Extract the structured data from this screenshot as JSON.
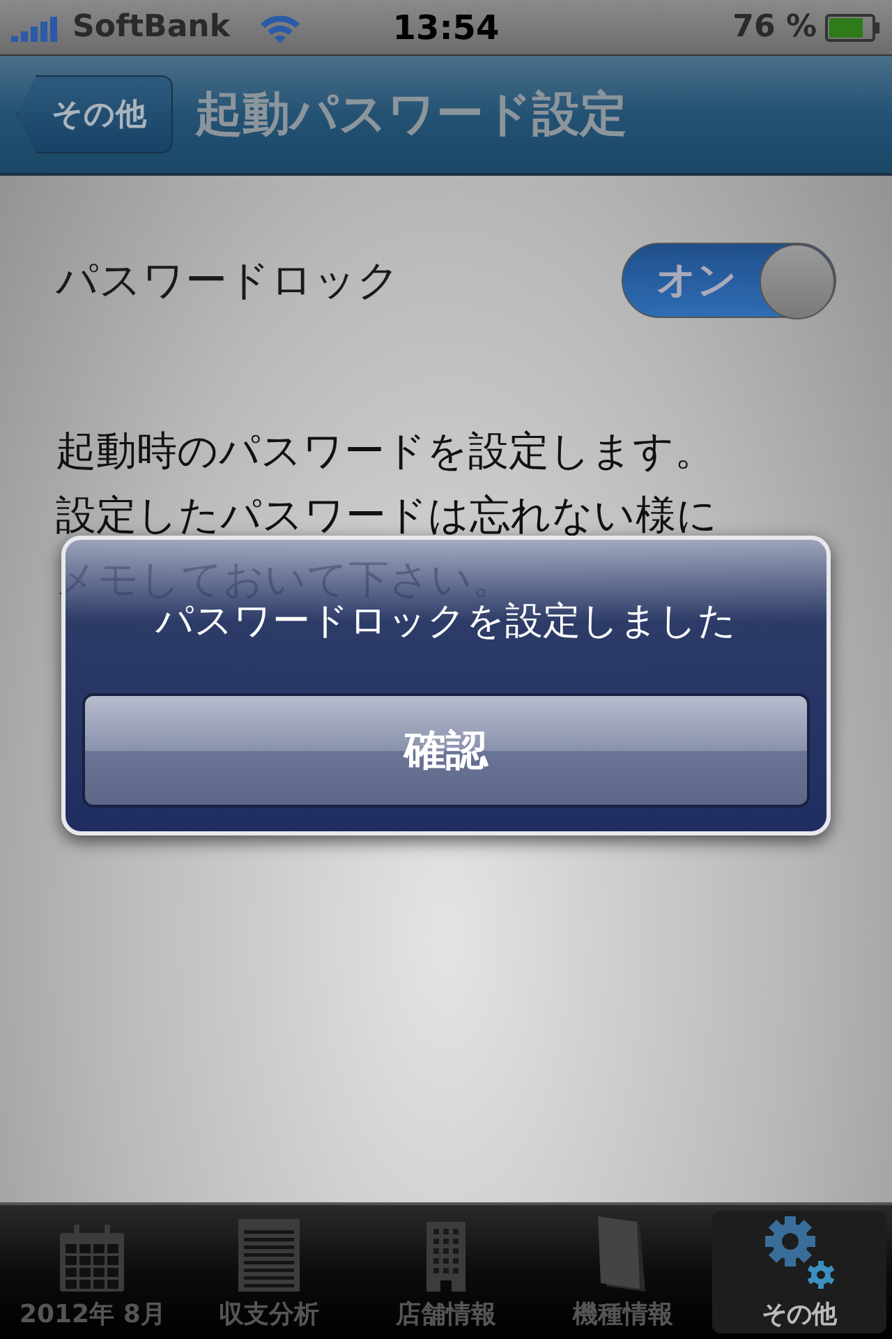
{
  "status_bar": {
    "carrier": "SoftBank",
    "time": "13:54",
    "battery": "76 %"
  },
  "nav_bar": {
    "back": "その他",
    "title": "起動パスワード設定"
  },
  "setting": {
    "label": "パスワードロック",
    "toggle": {
      "on": true,
      "label": "オン"
    }
  },
  "description": [
    "起動時のパスワードを設定します。",
    "設定したパスワードは忘れない様に",
    "メモしておいて下さい。"
  ],
  "alert": {
    "message": "パスワードロックを設定しました",
    "button": "確認"
  },
  "tab_bar": [
    {
      "kind": "calendar",
      "label": "2012年 8月",
      "selected": false
    },
    {
      "kind": "notepad",
      "label": "収支分析",
      "selected": false
    },
    {
      "kind": "building",
      "label": "店舗情報",
      "selected": false
    },
    {
      "kind": "book",
      "label": "機種情報",
      "selected": false
    },
    {
      "kind": "gears",
      "label": "その他",
      "selected": true
    }
  ]
}
